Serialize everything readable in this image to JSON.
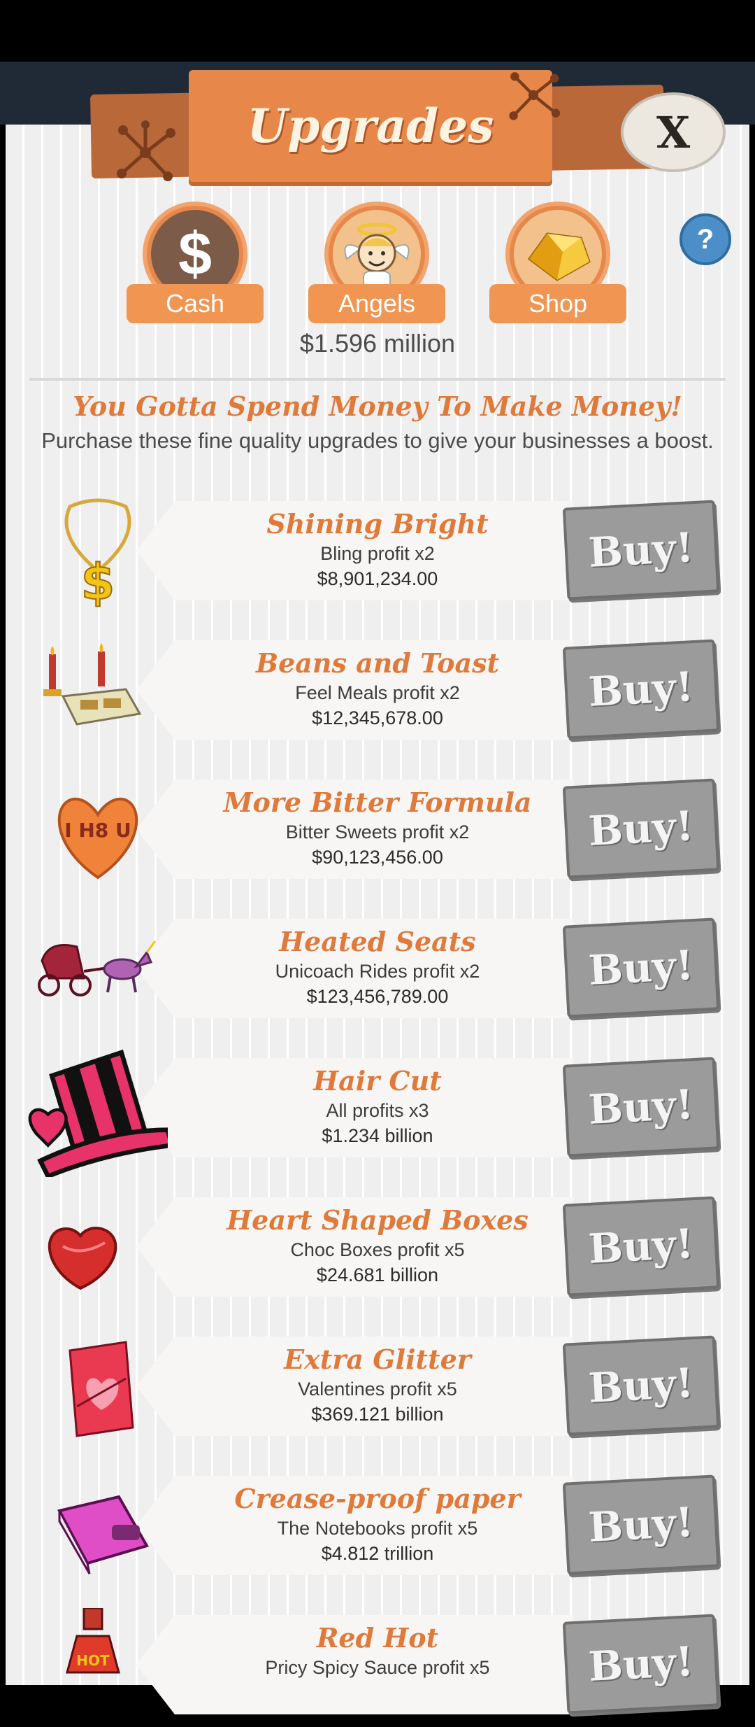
{
  "header": {
    "title": "Upgrades",
    "close_label": "X",
    "help_label": "?"
  },
  "tabs": [
    {
      "label": "Cash",
      "icon": "dollar-icon"
    },
    {
      "label": "Angels",
      "icon": "angel-icon"
    },
    {
      "label": "Shop",
      "icon": "gold-gem-icon"
    }
  ],
  "balance": "$1.596 million",
  "headline": "You Gotta Spend Money To Make Money!",
  "subline": "Purchase these fine quality upgrades to give your businesses a boost.",
  "buy_label": "Buy!",
  "upgrades": [
    {
      "name": "Shining Bright",
      "desc": "Bling profit x2",
      "price": "$8,901,234.00",
      "icon": "gold-chain-icon"
    },
    {
      "name": "Beans and Toast",
      "desc": "Feel Meals profit x2",
      "price": "$12,345,678.00",
      "icon": "candles-tray-icon"
    },
    {
      "name": "More Bitter Formula",
      "desc": "Bitter Sweets profit x2",
      "price": "$90,123,456.00",
      "icon": "candy-heart-icon",
      "icon_text": "I H8 U"
    },
    {
      "name": "Heated Seats",
      "desc": "Unicoach Rides profit x2",
      "price": "$123,456,789.00",
      "icon": "unicorn-carriage-icon"
    },
    {
      "name": "Hair Cut",
      "desc": "All profits x3",
      "price": "$1.234 billion",
      "icon": "striped-top-hat-icon"
    },
    {
      "name": "Heart Shaped Boxes",
      "desc": "Choc Boxes profit x5",
      "price": "$24.681 billion",
      "icon": "heart-box-icon"
    },
    {
      "name": "Extra Glitter",
      "desc": "Valentines profit x5",
      "price": "$369.121 billion",
      "icon": "valentine-card-icon"
    },
    {
      "name": "Crease-proof paper",
      "desc": "The Notebooks profit x5",
      "price": "$4.812 trillion",
      "icon": "notebook-icon"
    },
    {
      "name": "Red Hot",
      "desc": "Pricy Spicy Sauce profit x5",
      "price": "",
      "icon": "hot-sauce-icon",
      "icon_text": "HOT"
    }
  ]
}
